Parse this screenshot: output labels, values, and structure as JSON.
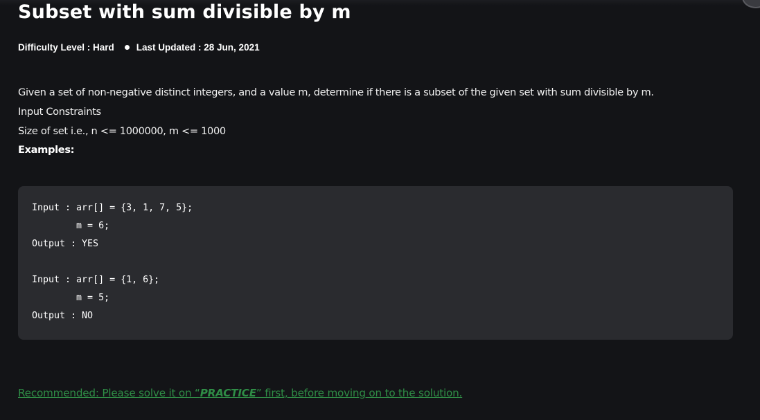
{
  "article": {
    "title": "Subset with sum divisible by m",
    "meta": {
      "difficulty": "Difficulty Level : Hard",
      "updated": "Last Updated : 28 Jun, 2021"
    },
    "paragraphs": [
      "Given a set of non-negative distinct integers, and a value m, determine if there is a subset of the given set with sum divisible by m.",
      "Input Constraints",
      "Size of set i.e., n <= 1000000, m <= 1000",
      "Examples:"
    ],
    "code_lines": [
      "Input : arr[] = {3, 1, 7, 5};",
      "        m = 6;",
      "Output : YES",
      "Input : arr[] = {1, 6};",
      "        m = 5;",
      "Output : NO"
    ],
    "recommend": {
      "before": "Recommended: Please solve it on “",
      "practice": "PRACTICE",
      "after": "” first, before moving on to the solution."
    }
  }
}
